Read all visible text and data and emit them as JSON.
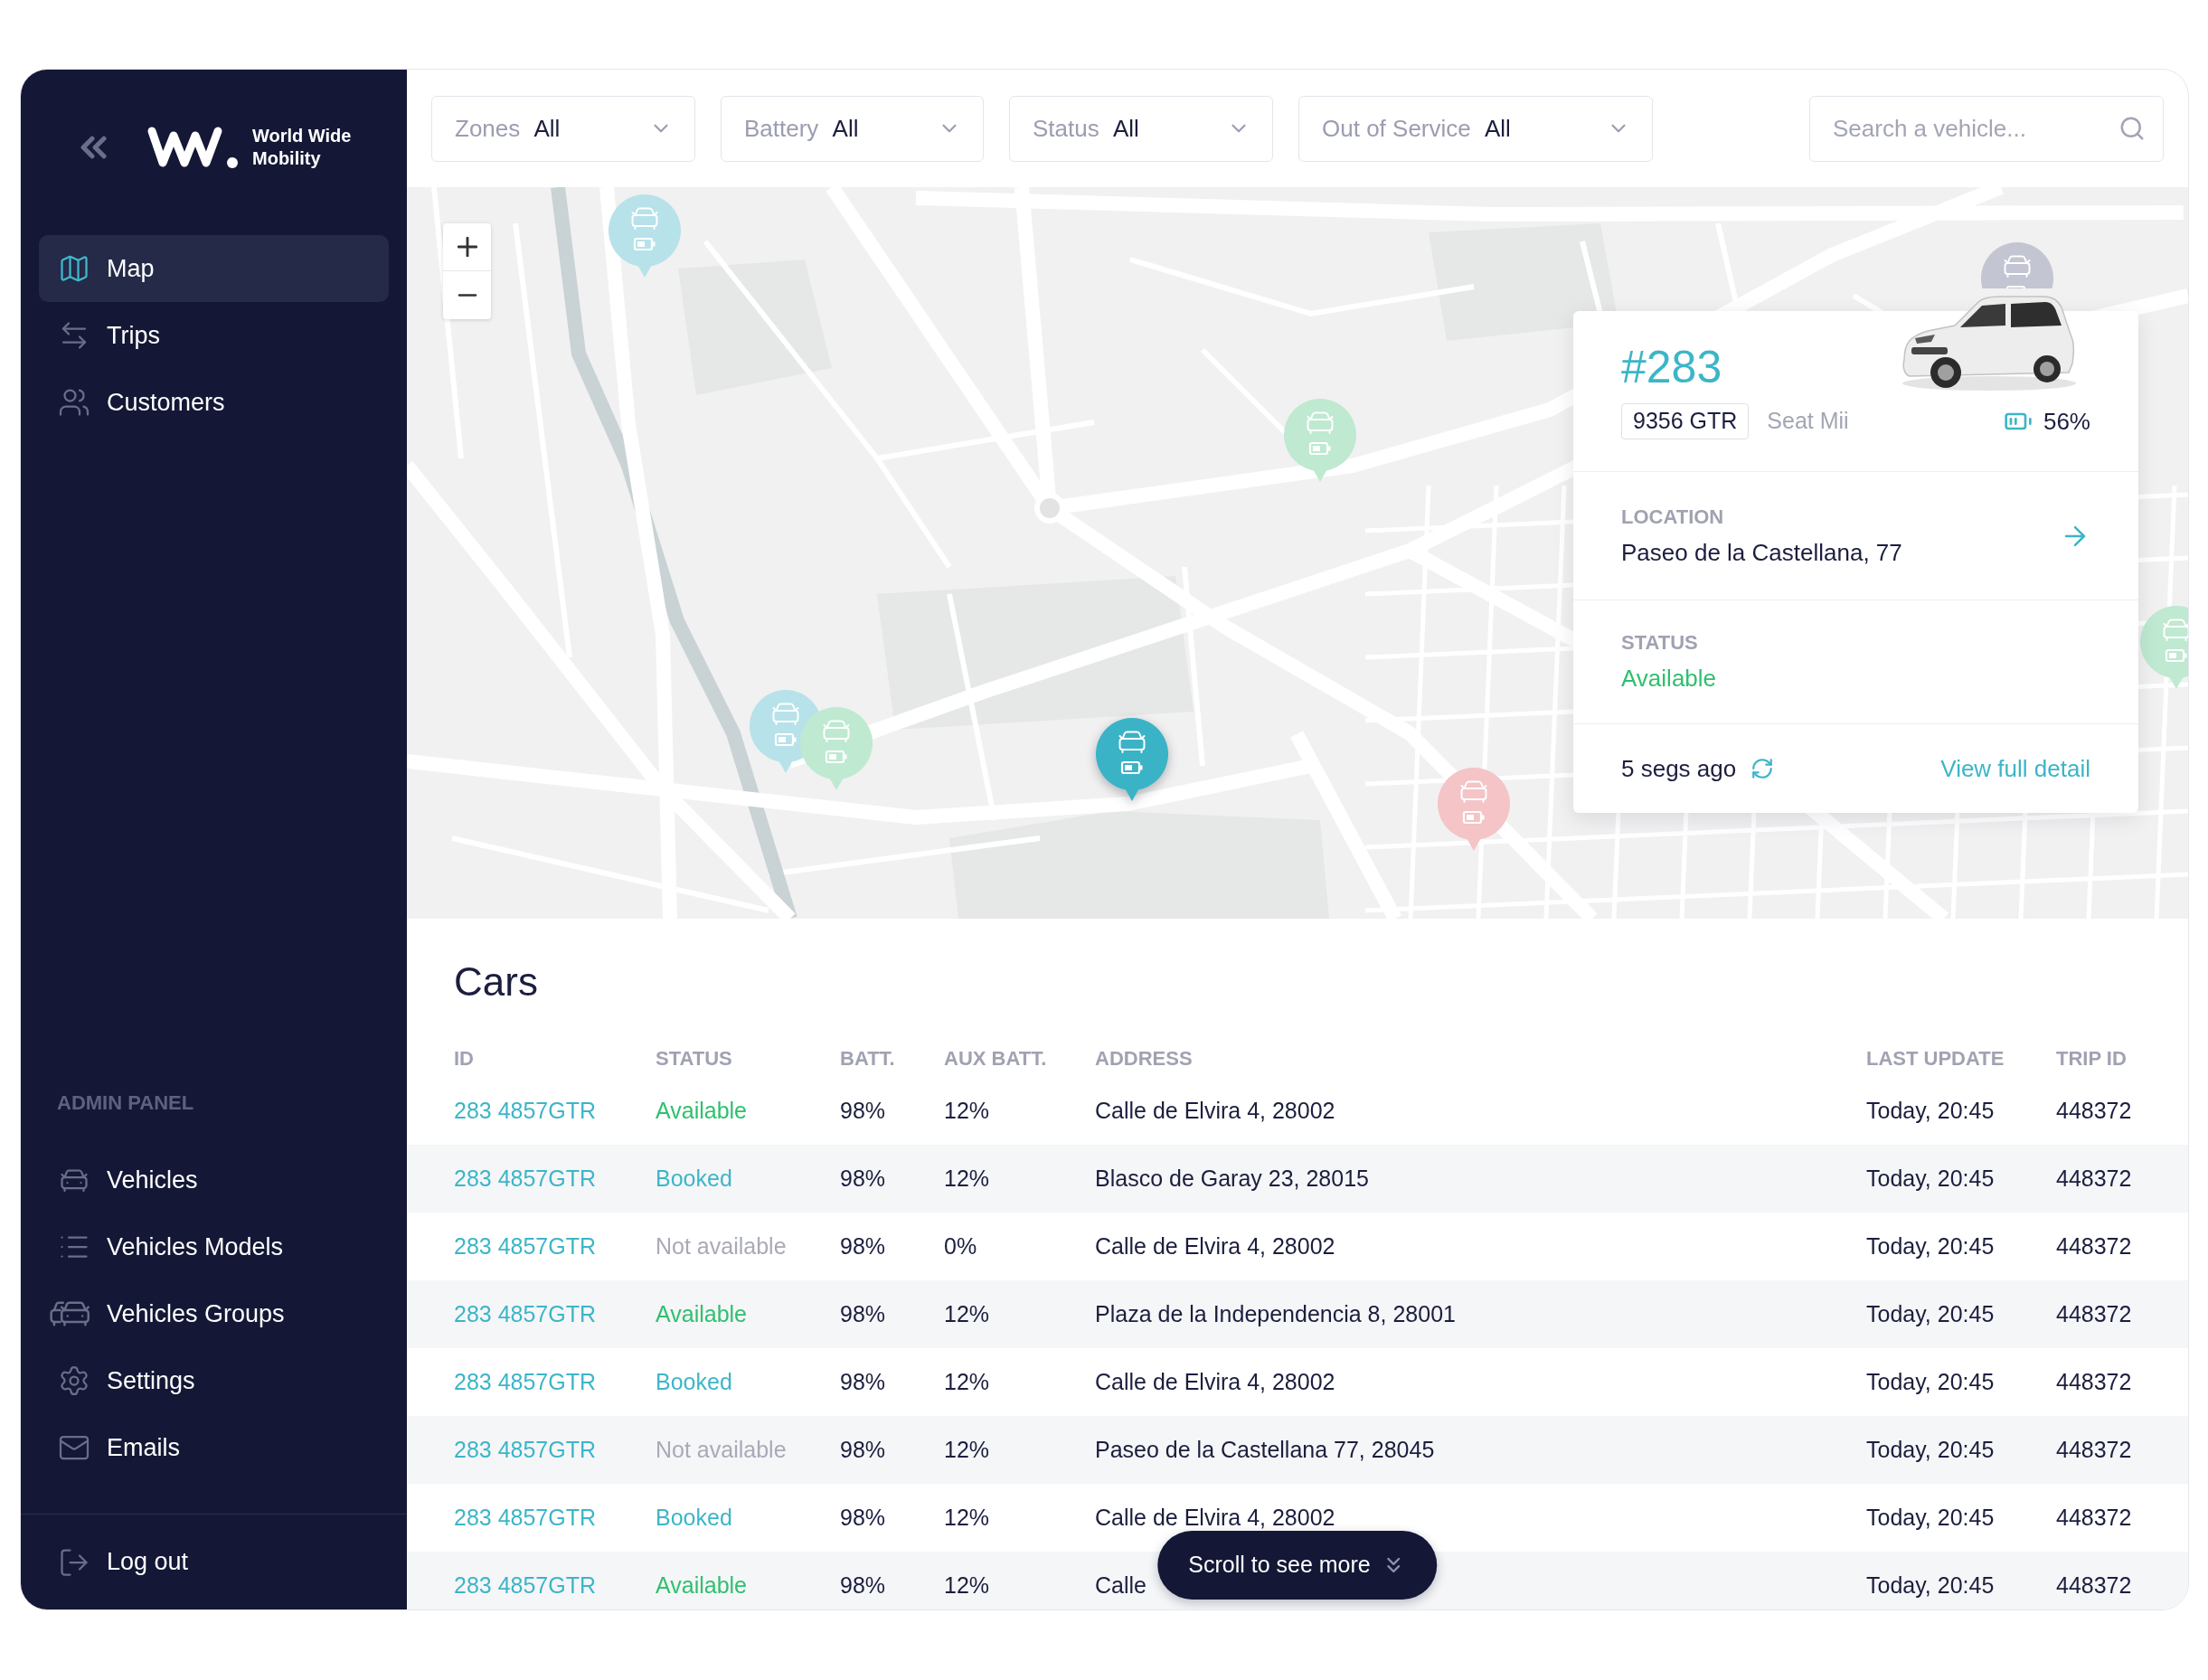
{
  "sidebar": {
    "brand": "World Wide Mobility",
    "nav": [
      {
        "label": "Map",
        "selected": true
      },
      {
        "label": "Trips",
        "selected": false
      },
      {
        "label": "Customers",
        "selected": false
      }
    ],
    "admin_panel": {
      "title": "ADMIN PANEL",
      "items": [
        {
          "label": "Vehicles",
          "selected": false
        },
        {
          "label": "Vehicles Models",
          "selected": false
        },
        {
          "label": "Vehicles Groups",
          "selected": false
        },
        {
          "label": "Settings",
          "selected": false
        },
        {
          "label": "Emails",
          "selected": false
        }
      ]
    },
    "logout": "Log out"
  },
  "filters": [
    {
      "label": "Zones",
      "value": "All"
    },
    {
      "label": "Battery",
      "value": "All"
    },
    {
      "label": "Status",
      "value": "All"
    },
    {
      "label": "Out of Service",
      "value": "All"
    }
  ],
  "search": {
    "placeholder": "Search a vehicle..."
  },
  "map": {
    "markers": [
      {
        "color": "#b7e2ea",
        "selected": false
      },
      {
        "color": "#c3c5d3",
        "selected": false
      },
      {
        "color": "#bfe9d1",
        "selected": false
      },
      {
        "color": "#bfe9d1",
        "selected": false
      },
      {
        "color": "#b7e2ea",
        "selected": false
      },
      {
        "color": "#bfe9d1",
        "selected": false
      },
      {
        "color": "#3bb3c6",
        "selected": true
      },
      {
        "color": "#f4c4c7",
        "selected": false
      }
    ],
    "vehicle_card": {
      "number": "#283",
      "plate": "9356 GTR",
      "model": "Seat Mii",
      "battery": "56%",
      "location": {
        "label": "LOCATION",
        "value": "Paseo de la Castellana, 77"
      },
      "status": {
        "label": "STATUS",
        "value": "Available"
      },
      "updated": "5 segs ago",
      "link": "View full detail"
    }
  },
  "cars": {
    "title": "Cars",
    "columns": [
      "ID",
      "STATUS",
      "BATT.",
      "AUX BATT.",
      "ADDRESS",
      "LAST UPDATE",
      "TRIP ID"
    ],
    "rows": [
      {
        "id": "283 4857GTR",
        "status": "Available",
        "color": "#2fc06e",
        "batt": "98%",
        "aux_batt": "12%",
        "address": "Calle de Elvira 4, 28002",
        "last_update": "Today, 20:45",
        "trip_id": "448372"
      },
      {
        "id": "283 4857GTR",
        "status": "Booked",
        "color": "#3db6c8",
        "batt": "98%",
        "aux_batt": "12%",
        "address": "Blasco de Garay 23, 28015",
        "last_update": "Today, 20:45",
        "trip_id": "448372"
      },
      {
        "id": "283 4857GTR",
        "status": "Not available",
        "color": "#a8aab8",
        "batt": "98%",
        "aux_batt": "0%",
        "address": "Calle de Elvira 4, 28002",
        "last_update": "Today, 20:45",
        "trip_id": "448372"
      },
      {
        "id": "283 4857GTR",
        "status": "Available",
        "color": "#2fc06e",
        "batt": "98%",
        "aux_batt": "12%",
        "address": "Plaza de la Independencia 8, 28001",
        "last_update": "Today, 20:45",
        "trip_id": "448372"
      },
      {
        "id": "283 4857GTR",
        "status": "Booked",
        "color": "#3db6c8",
        "batt": "98%",
        "aux_batt": "12%",
        "address": "Calle de Elvira 4, 28002",
        "last_update": "Today, 20:45",
        "trip_id": "448372"
      },
      {
        "id": "283 4857GTR",
        "status": "Not available",
        "color": "#a8aab8",
        "batt": "98%",
        "aux_batt": "12%",
        "address": "Paseo de la Castellana 77, 28045",
        "last_update": "Today, 20:45",
        "trip_id": "448372"
      },
      {
        "id": "283 4857GTR",
        "status": "Booked",
        "color": "#3db6c8",
        "batt": "98%",
        "aux_batt": "12%",
        "address": "Calle de Elvira 4, 28002",
        "last_update": "Today, 20:45",
        "trip_id": "448372"
      },
      {
        "id": "283 4857GTR",
        "status": "Available",
        "color": "#2fc06e",
        "batt": "98%",
        "aux_batt": "12%",
        "address": "Calle",
        "last_update": "Today, 20:45",
        "trip_id": "448372"
      }
    ],
    "scroll_hint": "Scroll to see more"
  }
}
